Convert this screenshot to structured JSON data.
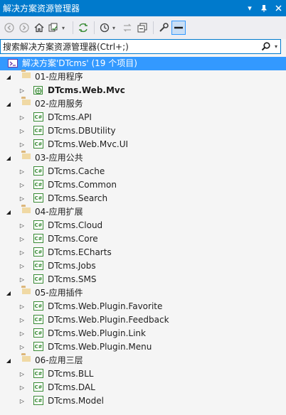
{
  "window": {
    "title": "解决方案资源管理器"
  },
  "title_buttons": [
    "dropdown-icon",
    "pin-icon",
    "close-icon"
  ],
  "toolbar": {
    "icons": [
      "back-icon",
      "forward-icon",
      "home-icon",
      "sync-icon",
      "pending-changes-icon",
      "history-icon",
      "collapse-icon",
      "copy-icon",
      "properties-icon",
      "preview-icon"
    ]
  },
  "search": {
    "placeholder": "搜索解决方案资源管理器(Ctrl+;)",
    "value": ""
  },
  "tree": {
    "solution": "解决方案'DTcms' (19 个项目)",
    "folders": [
      {
        "label": "01-应用程序",
        "projects": [
          {
            "label": "DTcms.Web.Mvc",
            "bold": true,
            "type": "web"
          }
        ]
      },
      {
        "label": "02-应用服务",
        "projects": [
          {
            "label": "DTcms.API"
          },
          {
            "label": "DTcms.DBUtility"
          },
          {
            "label": "DTcms.Web.Mvc.UI"
          }
        ]
      },
      {
        "label": "03-应用公共",
        "projects": [
          {
            "label": "DTcms.Cache"
          },
          {
            "label": "DTcms.Common"
          },
          {
            "label": "DTcms.Search"
          }
        ]
      },
      {
        "label": "04-应用扩展",
        "projects": [
          {
            "label": "DTcms.Cloud"
          },
          {
            "label": "DTcms.Core"
          },
          {
            "label": "DTcms.ECharts"
          },
          {
            "label": "DTcms.Jobs"
          },
          {
            "label": "DTcms.SMS"
          }
        ]
      },
      {
        "label": "05-应用插件",
        "projects": [
          {
            "label": "DTcms.Web.Plugin.Favorite"
          },
          {
            "label": "DTcms.Web.Plugin.Feedback"
          },
          {
            "label": "DTcms.Web.Plugin.Link"
          },
          {
            "label": "DTcms.Web.Plugin.Menu"
          }
        ]
      },
      {
        "label": "06-应用三层",
        "projects": [
          {
            "label": "DTcms.BLL"
          },
          {
            "label": "DTcms.DAL"
          },
          {
            "label": "DTcms.Model"
          }
        ]
      }
    ]
  },
  "colors": {
    "title_bg": "#007acc",
    "selection": "#3399ff",
    "folder": "#dcb67a",
    "cs_green": "#388a34"
  }
}
